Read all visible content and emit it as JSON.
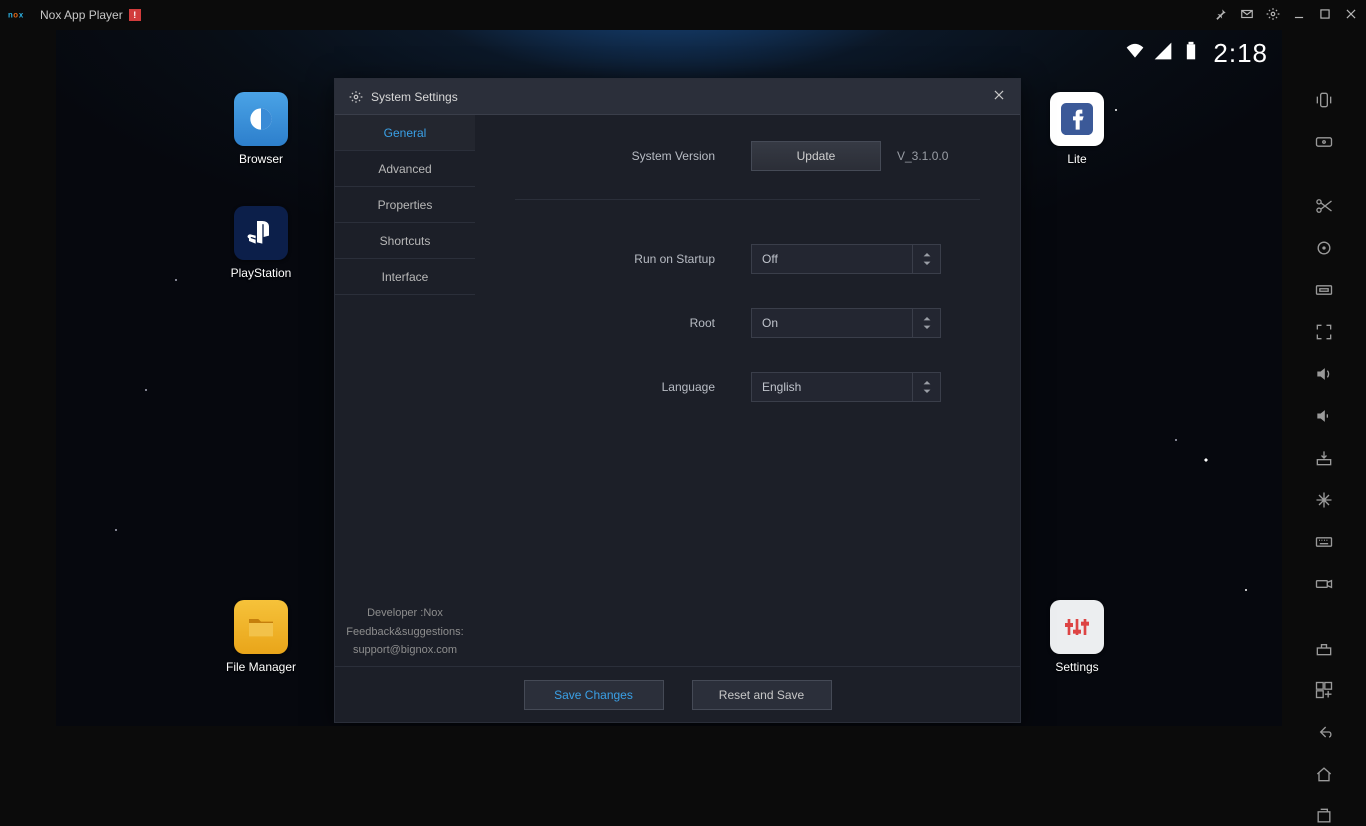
{
  "window": {
    "app_name_logo": "nox",
    "app_title": "Nox App Player"
  },
  "status": {
    "clock": "2:18"
  },
  "desktop": {
    "browser": "Browser",
    "playstation": "PlayStation",
    "file_manager": "File Manager",
    "lite": "Lite",
    "settings": "Settings"
  },
  "dialog": {
    "title": "System Settings",
    "tabs": [
      "General",
      "Advanced",
      "Properties",
      "Shortcuts",
      "Interface"
    ],
    "dev_info": {
      "line1": "Developer :Nox",
      "line2": "Feedback&suggestions:",
      "line3": "support@bignox.com"
    },
    "form": {
      "system_version_label": "System Version",
      "update_btn": "Update",
      "version_value": "V_3.1.0.0",
      "run_startup_label": "Run on Startup",
      "run_startup_value": "Off",
      "root_label": "Root",
      "root_value": "On",
      "language_label": "Language",
      "language_value": "English"
    },
    "footer": {
      "save": "Save Changes",
      "reset": "Reset and Save"
    }
  }
}
